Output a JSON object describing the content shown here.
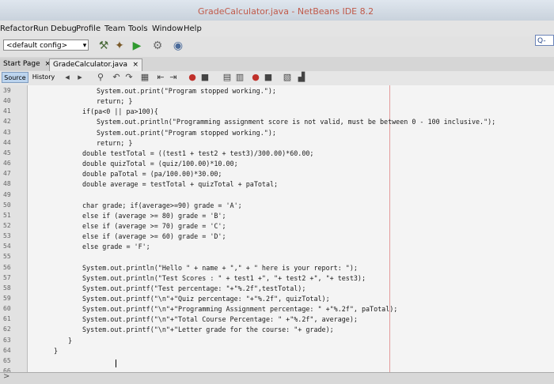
{
  "window": {
    "title": "GradeCalculator.java - NetBeans IDE 8.2"
  },
  "menu": [
    "Refactor",
    "Run",
    "Debug",
    "Profile",
    "Team",
    "Tools",
    "Window",
    "Help"
  ],
  "toolbar": {
    "config": "<default config>",
    "search_label": "Q-"
  },
  "tabs": [
    {
      "label": "Start Page",
      "close": "×"
    },
    {
      "label": "GradeCalculator.java",
      "close": "×"
    }
  ],
  "editor_toolbar": {
    "source": "Source",
    "history": "History"
  },
  "lines": [
    {
      "no": "39",
      "text": "System.out.print(\"Program stopped working.\");",
      "indent": 1
    },
    {
      "no": "40",
      "text": "return; }",
      "indent": 1
    },
    {
      "no": "41",
      "text": "if(pa<0 || pa>100){",
      "indent": 0
    },
    {
      "no": "42",
      "text": "System.out.println(\"Programming assignment score is not valid, must be between 0 - 100 inclusive.\");",
      "indent": 1
    },
    {
      "no": "43",
      "text": "System.out.print(\"Program stopped working.\");",
      "indent": 1
    },
    {
      "no": "44",
      "text": "return; }",
      "indent": 1
    },
    {
      "no": "45",
      "text": "double testTotal = ((test1 + test2 + test3)/300.00)*60.00;",
      "indent": 0
    },
    {
      "no": "46",
      "text": "double quizTotal = (quiz/100.00)*10.00;",
      "indent": 0
    },
    {
      "no": "47",
      "text": "double paTotal = (pa/100.00)*30.00;",
      "indent": 0
    },
    {
      "no": "48",
      "text": "double average = testTotal + quizTotal + paTotal;",
      "indent": 0
    },
    {
      "no": "49",
      "text": "",
      "indent": 0
    },
    {
      "no": "50",
      "text": "char grade; if(average>=90) grade = 'A';",
      "indent": 0
    },
    {
      "no": "51",
      "text": "else if (average >= 80) grade = 'B';",
      "indent": 0
    },
    {
      "no": "52",
      "text": "else if (average >= 70) grade = 'C';",
      "indent": 0
    },
    {
      "no": "53",
      "text": "else if (average >= 60) grade = 'D';",
      "indent": 0
    },
    {
      "no": "54",
      "text": "else grade = 'F';",
      "indent": 0
    },
    {
      "no": "55",
      "text": "",
      "indent": 0
    },
    {
      "no": "56",
      "text": "System.out.println(\"Hello \" + name + \",\" + \" here is your report: \");",
      "indent": 0
    },
    {
      "no": "57",
      "text": "System.out.println(\"Test Scores : \" + test1 +\", \"+ test2 +\", \"+ test3);",
      "indent": 0
    },
    {
      "no": "58",
      "text": "System.out.printf(\"Test percentage: \"+\"%.2f\",testTotal);",
      "indent": 0
    },
    {
      "no": "59",
      "text": "System.out.printf(\"\\n\"+\"Quiz percentage: \"+\"%.2f\", quizTotal);",
      "indent": 0
    },
    {
      "no": "60",
      "text": "System.out.printf(\"\\n\"+\"Programming Assignment percentage: \" +\"%.2f\", paTotal);",
      "indent": 0
    },
    {
      "no": "61",
      "text": "System.out.printf(\"\\n\"+\"Total Course Percentage: \" +\"%.2f\", average);",
      "indent": 0
    },
    {
      "no": "62",
      "text": "System.out.printf(\"\\n\"+\"Letter grade for the course: \"+ grade);",
      "indent": 0
    },
    {
      "no": "63",
      "text": "}",
      "indent": -1
    },
    {
      "no": "64",
      "text": "}",
      "indent": -2
    },
    {
      "no": "65",
      "text": "",
      "indent": 0
    },
    {
      "no": "66",
      "text": "",
      "indent": 0
    }
  ],
  "status": {
    "arrow": ">"
  }
}
